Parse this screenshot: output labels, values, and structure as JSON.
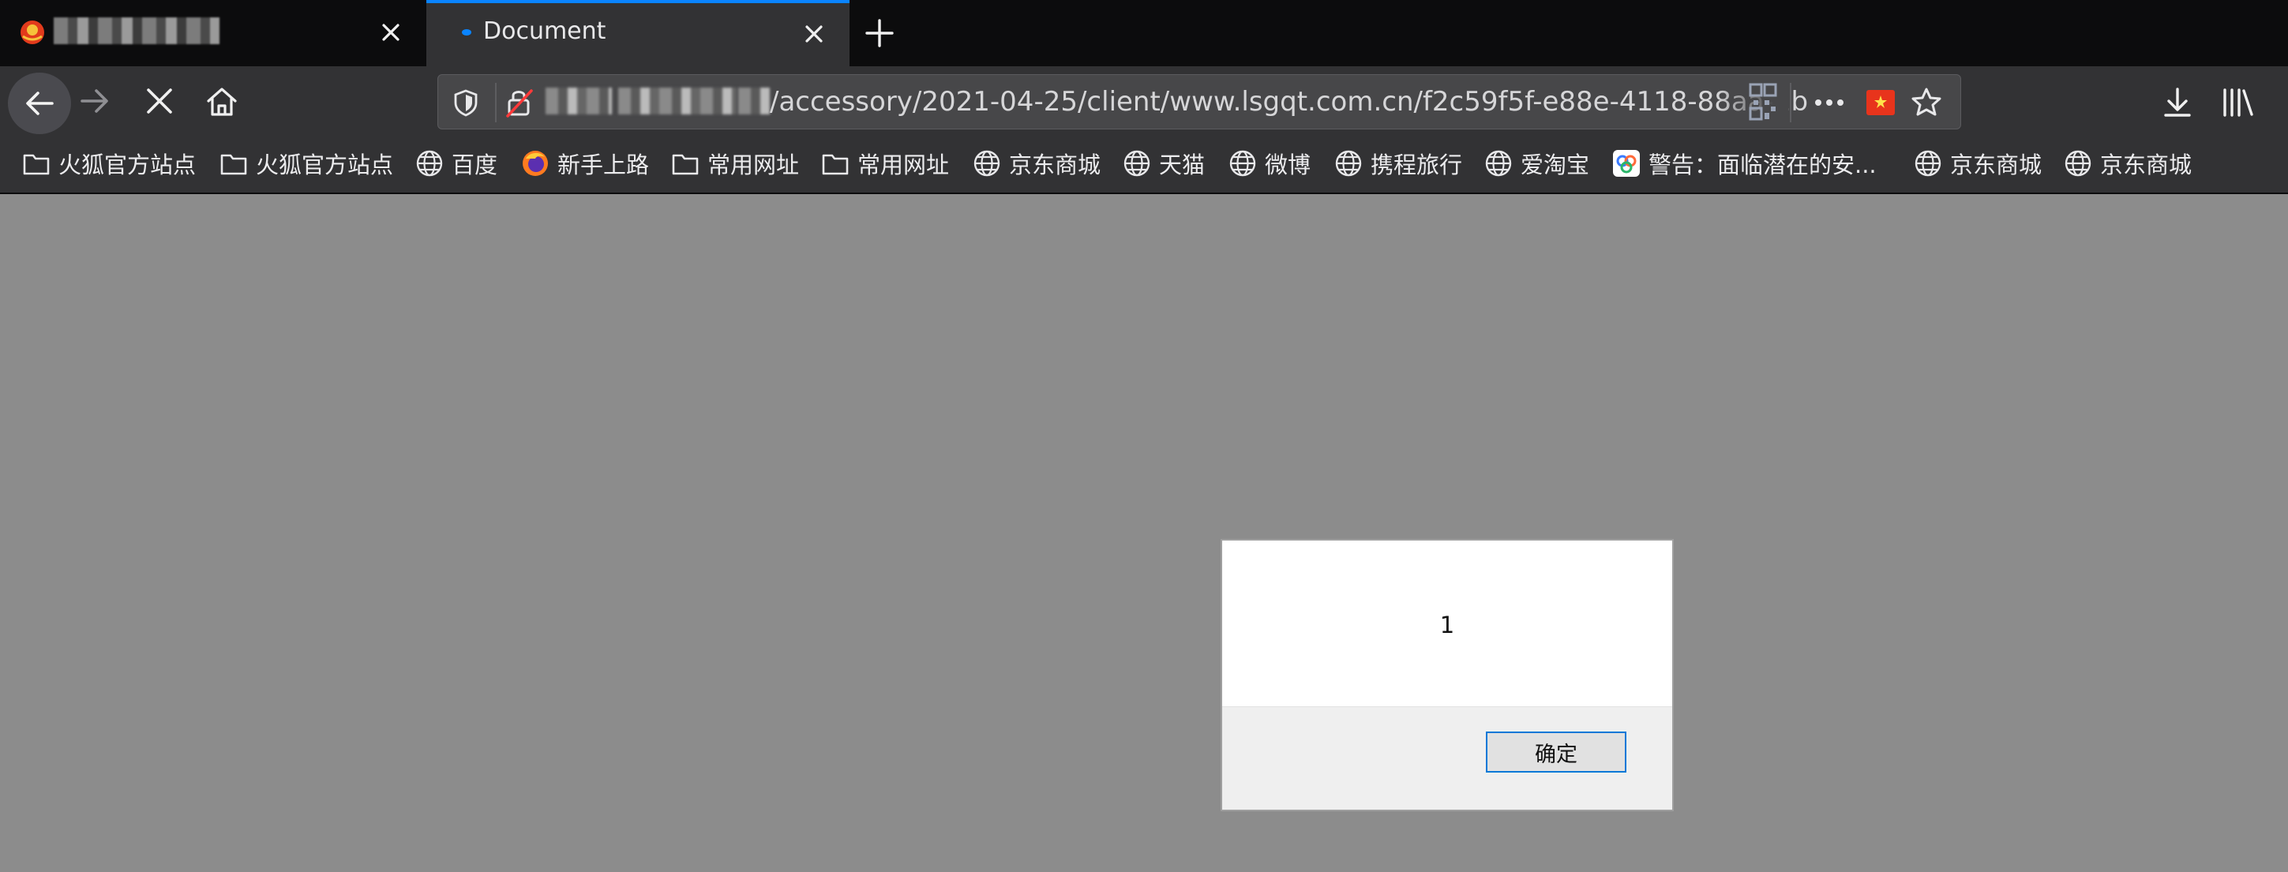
{
  "tabs": [
    {
      "title": "",
      "favicon": "red-emblem-icon",
      "title_obscured": true
    },
    {
      "title": "Document",
      "favicon": "loading-dot-icon",
      "active": true
    }
  ],
  "toolbar": {
    "url": "/accessory/2021-04-25/client/www.lsgqt.com.cn/f2c59f5f-e88e-4118-88aa-2b",
    "url_domain_obscured": true,
    "icons": [
      "back-arrow-icon",
      "forward-arrow-icon",
      "stop-icon",
      "home-icon",
      "shield-icon",
      "insecure-lock-icon",
      "qr-code-icon",
      "more-icon",
      "flag-icon",
      "star-icon",
      "download-icon",
      "library-icon"
    ]
  },
  "bookmarks": [
    {
      "label": "火狐官方站点",
      "icon": "folder-icon"
    },
    {
      "label": "火狐官方站点",
      "icon": "folder-icon"
    },
    {
      "label": "百度",
      "icon": "globe-icon"
    },
    {
      "label": "新手上路",
      "icon": "firefox-icon"
    },
    {
      "label": "常用网址",
      "icon": "folder-icon"
    },
    {
      "label": "常用网址",
      "icon": "folder-icon"
    },
    {
      "label": "京东商城",
      "icon": "globe-icon"
    },
    {
      "label": "天猫",
      "icon": "globe-icon"
    },
    {
      "label": "微博",
      "icon": "globe-icon"
    },
    {
      "label": "携程旅行",
      "icon": "globe-icon"
    },
    {
      "label": "爱淘宝",
      "icon": "globe-icon"
    },
    {
      "label": "警告：面临潜在的安...",
      "icon": "warning-site-icon"
    },
    {
      "label": "京东商城",
      "icon": "globe-icon"
    },
    {
      "label": "京东商城",
      "icon": "globe-icon"
    }
  ],
  "dialog": {
    "message": "1",
    "ok_label": "确定"
  },
  "colors": {
    "accent": "#0a84ff",
    "page_overlay": "#8c8c8c",
    "tabbar": "#0c0c0d",
    "toolbar": "#323234"
  }
}
